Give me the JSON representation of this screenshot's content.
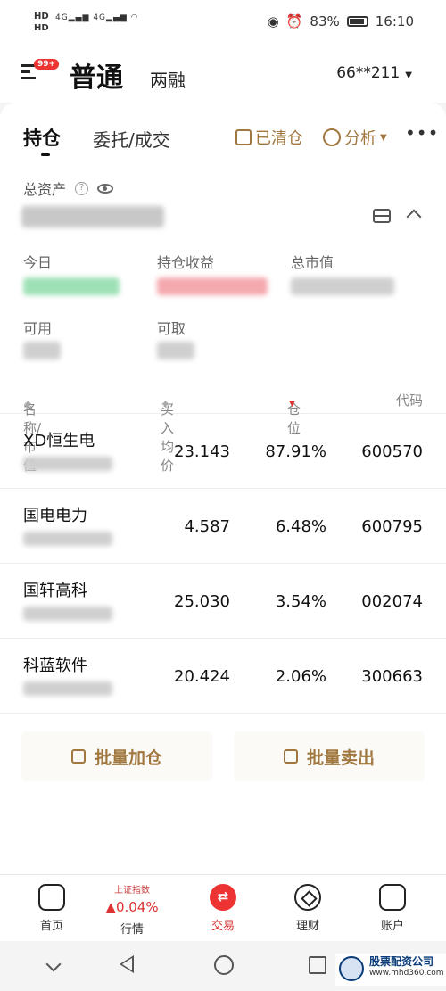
{
  "status_bar": {
    "hd_labels": [
      "HD",
      "HD"
    ],
    "signal_labels": [
      "4G",
      "4G"
    ],
    "battery": "83%",
    "time": "16:10"
  },
  "header": {
    "badge": "99+",
    "tabs": [
      "普通",
      "两融"
    ],
    "account": "66**211"
  },
  "top_nav": {
    "hold": "持仓",
    "orders": "委托/成交",
    "cleared": "已清仓",
    "analysis": "分析"
  },
  "assets": {
    "total_label": "总资产",
    "metrics": [
      {
        "label": "今日"
      },
      {
        "label": "持仓收益"
      },
      {
        "label": "总市值"
      },
      {
        "label": "可用"
      },
      {
        "label": "可取"
      }
    ]
  },
  "table": {
    "headers": [
      "名称/市值",
      "买入均价",
      "仓位",
      "代码"
    ],
    "rows": [
      {
        "name": "XD恒生电",
        "cost": "23.143",
        "position": "87.91%",
        "code": "600570"
      },
      {
        "name": "国电电力",
        "cost": "4.587",
        "position": "6.48%",
        "code": "600795"
      },
      {
        "name": "国轩高科",
        "cost": "25.030",
        "position": "3.54%",
        "code": "002074"
      },
      {
        "name": "科蓝软件",
        "cost": "20.424",
        "position": "2.06%",
        "code": "300663"
      }
    ]
  },
  "actions": {
    "batch_add": "批量加仓",
    "batch_sell": "批量卖出"
  },
  "bottom_nav": {
    "home": "首页",
    "index_name": "上证指数",
    "index_change": "▲0.04%",
    "market": "行情",
    "trade": "交易",
    "wealth": "理财",
    "account": "账户"
  },
  "watermark": {
    "title": "股票配资公司",
    "url": "www.mhd360.com"
  },
  "colors": {
    "accent_gold": "#a0773e",
    "red": "#e33333"
  }
}
